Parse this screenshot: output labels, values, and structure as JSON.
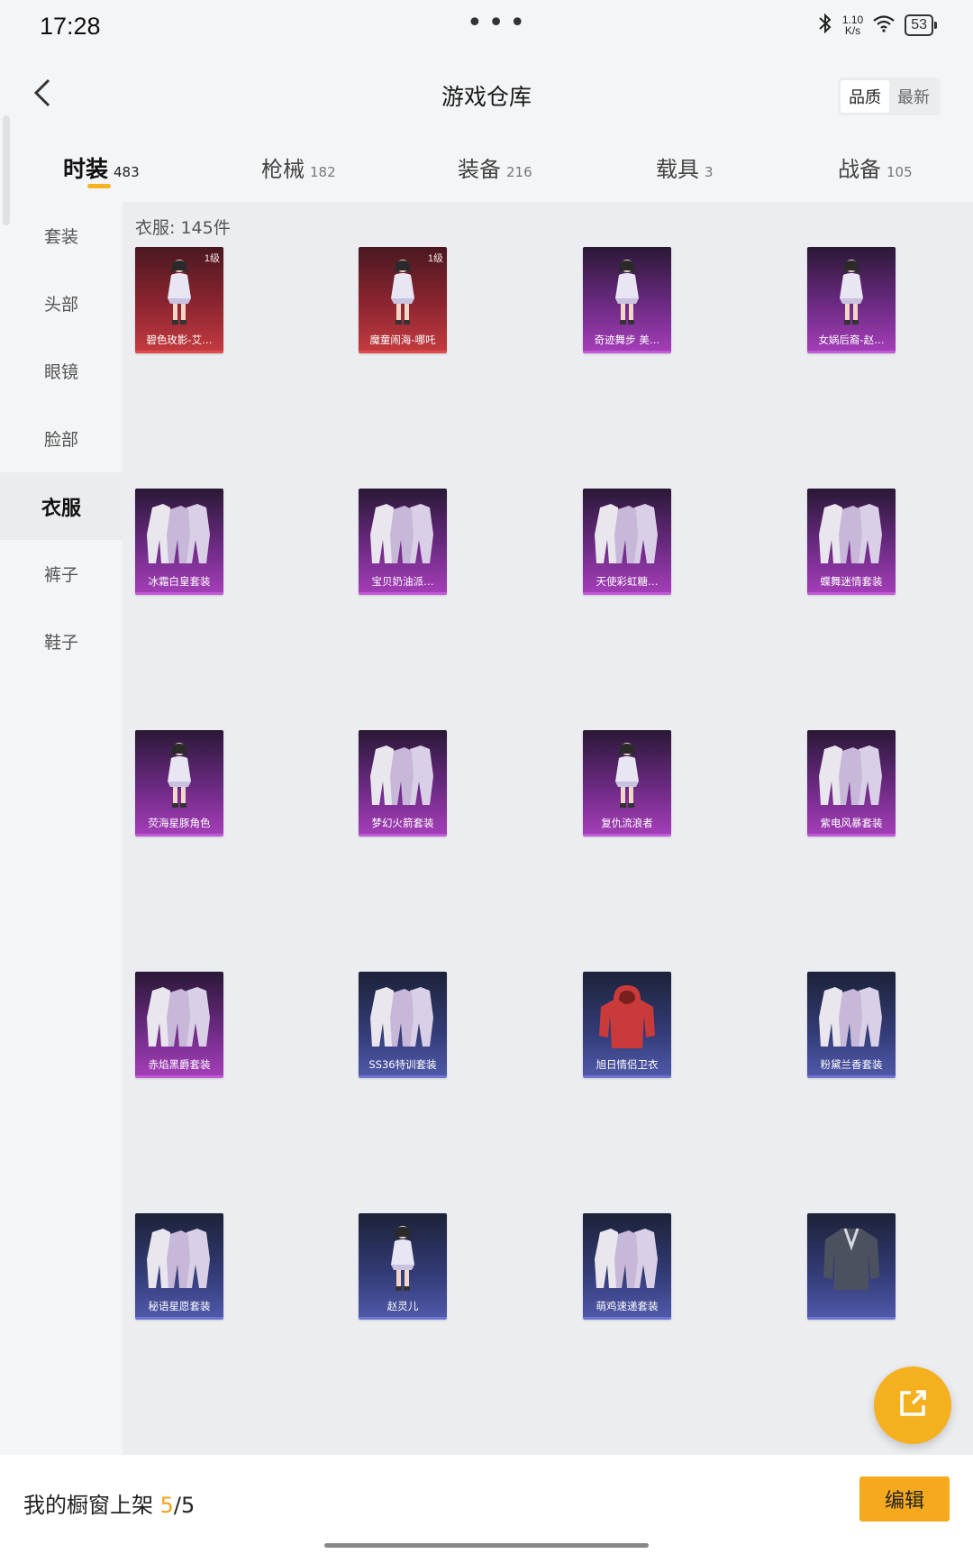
{
  "status": {
    "time": "17:28",
    "dots": "•••",
    "net_speed_value": "1.10",
    "net_speed_unit": "K/s",
    "battery": "53"
  },
  "header": {
    "title": "游戏仓库",
    "sort_options": [
      "品质",
      "最新"
    ],
    "active_sort": "品质"
  },
  "tabs": [
    {
      "label": "时装",
      "count": "483",
      "active": true
    },
    {
      "label": "枪械",
      "count": "182",
      "active": false
    },
    {
      "label": "装备",
      "count": "216",
      "active": false
    },
    {
      "label": "载具",
      "count": "3",
      "active": false
    },
    {
      "label": "战备",
      "count": "105",
      "active": false
    }
  ],
  "sidebar": {
    "items": [
      {
        "label": "套装"
      },
      {
        "label": "头部"
      },
      {
        "label": "眼镜"
      },
      {
        "label": "脸部"
      },
      {
        "label": "衣服",
        "active": true
      },
      {
        "label": "裤子"
      },
      {
        "label": "鞋子"
      }
    ]
  },
  "content": {
    "count_label": "衣服: 145件",
    "items": [
      {
        "name": "碧色玫影-艾…",
        "level": "1级",
        "rarity": "red",
        "icon": "character-figure-icon"
      },
      {
        "name": "魔童闹海-哪吒",
        "level": "1级",
        "rarity": "red",
        "icon": "character-figure-icon"
      },
      {
        "name": "奇迹舞步 美…",
        "level": "",
        "rarity": "purple",
        "icon": "character-figure-icon"
      },
      {
        "name": "女娲后裔-赵…",
        "level": "",
        "rarity": "purple",
        "icon": "character-figure-icon"
      },
      {
        "name": "冰霜白皇套装",
        "level": "",
        "rarity": "purple",
        "icon": "outfit-set-icon"
      },
      {
        "name": "宝贝奶油派…",
        "level": "",
        "rarity": "purple",
        "icon": "outfit-set-icon"
      },
      {
        "name": "天使彩虹糖…",
        "level": "",
        "rarity": "purple",
        "icon": "outfit-set-icon"
      },
      {
        "name": "蝶舞迷情套装",
        "level": "",
        "rarity": "purple",
        "icon": "outfit-set-icon"
      },
      {
        "name": "荧海星豚角色",
        "level": "",
        "rarity": "purple",
        "icon": "character-figure-icon"
      },
      {
        "name": "梦幻火箭套装",
        "level": "",
        "rarity": "purple",
        "icon": "outfit-set-icon"
      },
      {
        "name": "复仇流浪者",
        "level": "",
        "rarity": "purple",
        "icon": "character-figure-icon"
      },
      {
        "name": "紫电风暴套装",
        "level": "",
        "rarity": "purple",
        "icon": "outfit-set-icon"
      },
      {
        "name": "赤焰黑爵套装",
        "level": "",
        "rarity": "purple",
        "icon": "outfit-set-icon"
      },
      {
        "name": "SS36特训套装",
        "level": "",
        "rarity": "blue",
        "icon": "outfit-set-icon"
      },
      {
        "name": "旭日情侣卫衣",
        "level": "",
        "rarity": "blue",
        "icon": "hoodie-icon"
      },
      {
        "name": "粉黛兰香套装",
        "level": "",
        "rarity": "blue",
        "icon": "outfit-set-icon"
      },
      {
        "name": "秘语星愿套装",
        "level": "",
        "rarity": "blue",
        "icon": "outfit-set-icon"
      },
      {
        "name": "赵灵儿",
        "level": "",
        "rarity": "blue",
        "icon": "character-figure-icon"
      },
      {
        "name": "萌鸡速递套装",
        "level": "",
        "rarity": "blue",
        "icon": "outfit-set-icon"
      },
      {
        "name": "",
        "level": "",
        "rarity": "blue",
        "icon": "jacket-icon"
      }
    ]
  },
  "bottom": {
    "showcase_label": "我的橱窗上架 ",
    "showcase_current": "5",
    "showcase_total": "/5",
    "edit_label": "编辑"
  },
  "colors": {
    "accent": "#f5a91c",
    "red_rarity": "#e24b4f",
    "purple_rarity": "#c05ad6",
    "blue_rarity": "#6c76cf"
  }
}
